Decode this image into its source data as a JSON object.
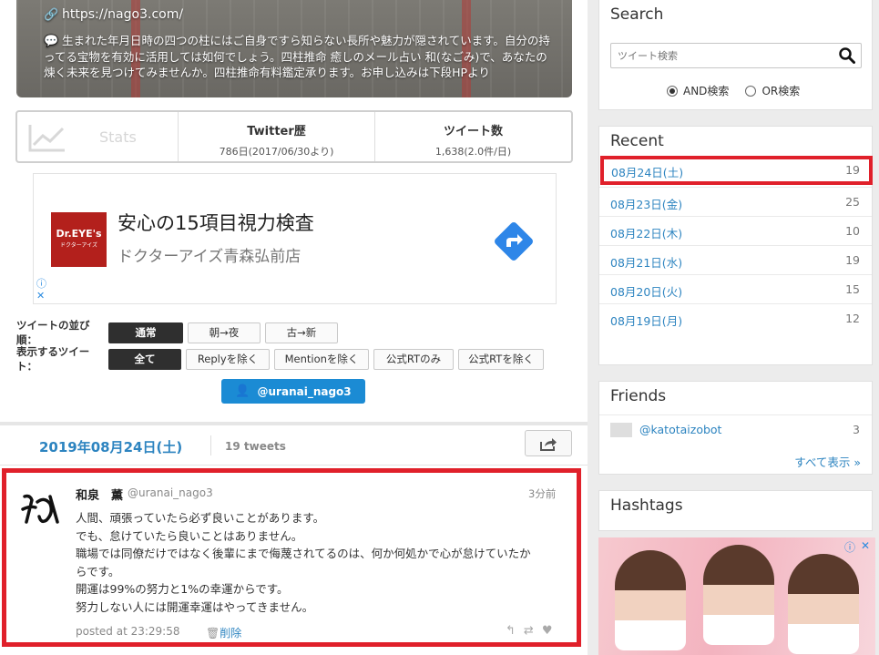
{
  "profile": {
    "url": "https://nago3.com/",
    "description": "生まれた年月日時の四つの柱にはご自身ですら知らない長所や魅力が隠されています。自分の持ってる宝物を有効に活用しては如何でしょう。四柱推命 癒しのメール占い 和(なごみ)で、あなたの煉く未来を見つけてみませんか。四柱推命有料鑑定承ります。お申し込みは下段HPより"
  },
  "stats": {
    "label": "Stats",
    "twitter_title": "Twitter歴",
    "twitter_value": "786日(2017/06/30より)",
    "tweets_title": "ツイート数",
    "tweets_value": "1,638(2.0件/日)"
  },
  "ad": {
    "logo": "Dr.EYE's",
    "logo_sub": "ドクターアイズ",
    "headline": "安心の15項目視力検査",
    "sub": "ドクターアイズ青森弘前店"
  },
  "sort": {
    "label": "ツイートの並び順：",
    "options": [
      "通常",
      "朝→夜",
      "古→新"
    ]
  },
  "show": {
    "label": "表示するツイート：",
    "options": [
      "全て",
      "Replyを除く",
      "Mentionを除く",
      "公式RTのみ",
      "公式RTを除く"
    ]
  },
  "follow_button": "@uranai_nago3",
  "day": {
    "date": "2019年08月24日(土)",
    "count": "19 tweets"
  },
  "tweet": {
    "name": "和泉　薫",
    "handle": "@uranai_nago3",
    "time": "3分前",
    "lines": [
      "人間、頑張っていたら必ず良いことがあります。",
      "でも、怠けていたら良いことはありません。",
      "職場では同僚だけではなく後輩にまで侮蔑されてるのは、何か何処かで心が怠けていたか",
      "らです。",
      "開運は99%の努力と1%の幸運からです。",
      "努力しない人には開運幸運はやってきません。"
    ],
    "posted": "posted at 23:29:58",
    "delete": "削除"
  },
  "sidebar": {
    "search": {
      "title": "Search",
      "placeholder": "ツイート検索",
      "and_label": "AND検索",
      "or_label": "OR検索"
    },
    "recent": {
      "title": "Recent",
      "items": [
        {
          "label": "08月24日(土)",
          "count": "19"
        },
        {
          "label": "08月23日(金)",
          "count": "25"
        },
        {
          "label": "08月22日(木)",
          "count": "10"
        },
        {
          "label": "08月21日(水)",
          "count": "19"
        },
        {
          "label": "08月20日(火)",
          "count": "15"
        },
        {
          "label": "08月19日(月)",
          "count": "12"
        }
      ]
    },
    "friends": {
      "title": "Friends",
      "name": "@katotaizobot",
      "count": "3",
      "show_all": "すべて表示 »"
    },
    "hashtags": {
      "title": "Hashtags"
    }
  },
  "colors": {
    "accent": "#2d84c0",
    "highlight": "#e0202a",
    "follow": "#1b8bd4"
  }
}
